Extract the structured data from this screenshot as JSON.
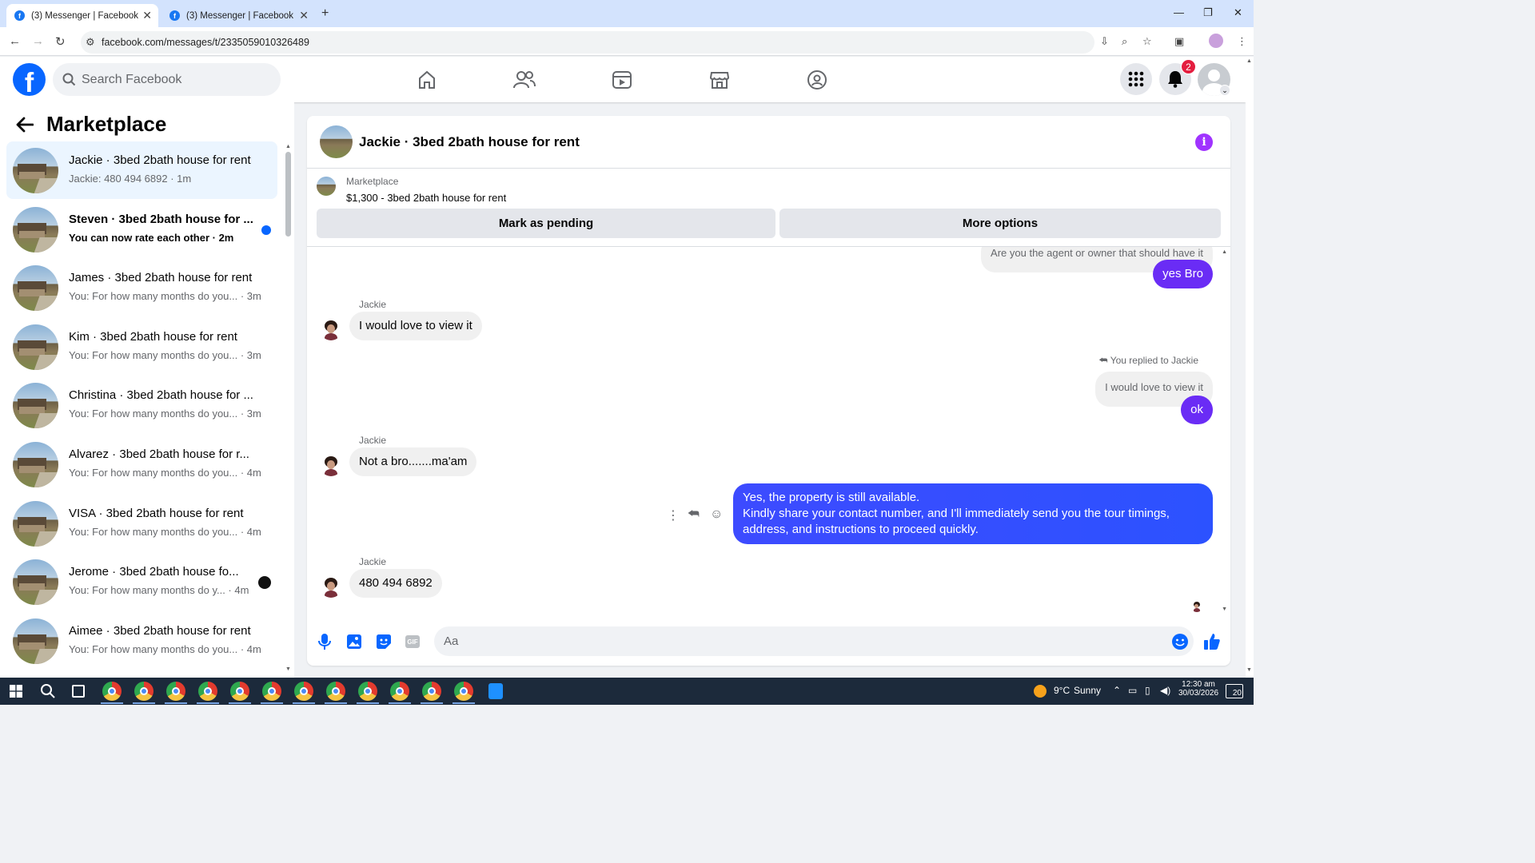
{
  "browser": {
    "tabs": [
      {
        "title": "(3) Messenger | Facebook",
        "active": true
      },
      {
        "title": "(3) Messenger | Facebook",
        "active": false
      }
    ],
    "url": "facebook.com/messages/t/2335059010326489"
  },
  "fb_header": {
    "search_placeholder": "Search Facebook",
    "notification_count": "2",
    "logo_letter": "f"
  },
  "sidebar": {
    "title": "Marketplace",
    "conversations": [
      {
        "name": "Jackie · 3bed 2bath house for rent",
        "preview": "Jackie: 480 494 6892 · 1m",
        "selected": true,
        "unread": false
      },
      {
        "name": "Steven · 3bed 2bath house for ...",
        "preview": "You can now rate each other · 2m",
        "selected": false,
        "unread": true
      },
      {
        "name": "James · 3bed 2bath house for rent",
        "preview": "You: For how many months do you... · 3m",
        "selected": false,
        "unread": false
      },
      {
        "name": "Kim · 3bed 2bath house for rent",
        "preview": "You: For how many months do you... · 3m",
        "selected": false,
        "unread": false
      },
      {
        "name": "Christina · 3bed 2bath house for ...",
        "preview": "You: For how many months do you... · 3m",
        "selected": false,
        "unread": false
      },
      {
        "name": "Alvarez · 3bed 2bath house for r...",
        "preview": "You: For how many months do you... · 4m",
        "selected": false,
        "unread": false
      },
      {
        "name": "VISA · 3bed 2bath house for rent",
        "preview": "You: For how many months do you... · 4m",
        "selected": false,
        "unread": false
      },
      {
        "name": "Jerome · 3bed 2bath house fo...",
        "preview": "You: For how many months do y... · 4m",
        "selected": false,
        "unread": false
      },
      {
        "name": "Aimee · 3bed 2bath house for rent",
        "preview": "You: For how many months do you... · 4m",
        "selected": false,
        "unread": false
      }
    ]
  },
  "chat": {
    "title": "Jackie · 3bed 2bath house for rent",
    "marketplace_label": "Marketplace",
    "listing": "$1,300 - 3bed 2bath house for rent",
    "buttons": {
      "pending": "Mark as pending",
      "more": "More options"
    },
    "messages": {
      "quoted_top": "Are you the agent or owner that should have it",
      "out_1": "yes Bro",
      "sender": "Jackie",
      "in_1": "I would love to view it",
      "replied_to": "You replied to Jackie",
      "quoted_reply": "I would love to view it",
      "out_2": "ok",
      "in_2": "Not a bro.......ma'am",
      "out_3_line1": "Yes, the property is still available.",
      "out_3_line2": "Kindly share your contact number, and I'll immediately send you the tour timings, address, and instructions to proceed quickly.",
      "in_3": "480 494 6892"
    },
    "composer_placeholder": "Aa"
  },
  "taskbar": {
    "weather_temp": "9°C",
    "weather_text": "Sunny",
    "time": "12:30 am",
    "date": "30/03/2026",
    "notif_count": "20"
  },
  "colors": {
    "fb_blue": "#0866ff",
    "bubble_out": "#2c52ff",
    "bubble_in": "#f0f0f0",
    "info_purple": "#a033ff",
    "badge_red": "#e41e3f"
  }
}
